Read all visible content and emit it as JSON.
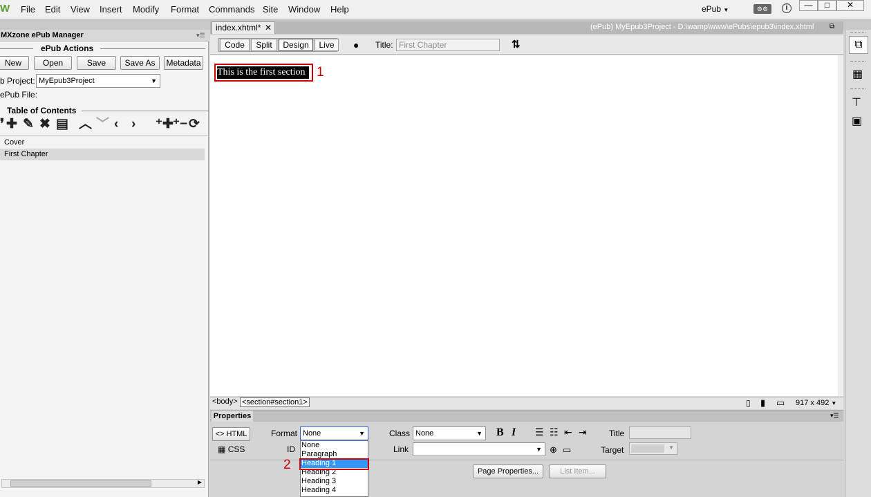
{
  "menubar": {
    "logo": "W",
    "items": [
      "File",
      "Edit",
      "View",
      "Insert",
      "Modify",
      "Format",
      "Commands",
      "Site",
      "Window",
      "Help"
    ],
    "workspace": "ePub"
  },
  "left_panel": {
    "title": "MXzone ePub Manager",
    "actions_title": "ePub Actions",
    "buttons": {
      "new": "New",
      "open": "Open",
      "save": "Save",
      "save_as": "Save As",
      "metadata": "Metadata"
    },
    "project_label": "b Project:",
    "project_value": "MyEpub3Project",
    "file_label": "ePub File:",
    "toc_title": "Table of Contents",
    "toc_items": [
      "Cover",
      "First Chapter"
    ]
  },
  "document": {
    "tab_name": "index.xhtml*",
    "path": "(ePub) MyEpub3Project - D:\\wamp\\www\\ePubs\\epub3\\index.xhtml",
    "view_buttons": {
      "code": "Code",
      "split": "Split",
      "design": "Design",
      "live": "Live"
    },
    "title_label": "Title:",
    "title_value": "First Chapter",
    "selected_text": "This is the first section",
    "annotation_1": "1",
    "annotation_2": "2"
  },
  "status": {
    "tag_body": "<body>",
    "tag_section": "<section#section1>",
    "size": "917 x 492"
  },
  "properties": {
    "tab": "Properties",
    "html_btn": "HTML",
    "css_btn": "CSS",
    "format_label": "Format",
    "format_value": "None",
    "id_label": "ID",
    "class_label": "Class",
    "class_value": "None",
    "link_label": "Link",
    "title_label": "Title",
    "target_label": "Target",
    "page_props_btn": "Page Properties...",
    "list_item_btn": "List Item...",
    "format_options": [
      "None",
      "Paragraph",
      "Heading 1",
      "Heading 2",
      "Heading 3",
      "Heading 4"
    ],
    "selected_option": "Heading 1"
  },
  "colors": {
    "accent_red": "#cc0000",
    "selection_blue": "#3399ff"
  }
}
